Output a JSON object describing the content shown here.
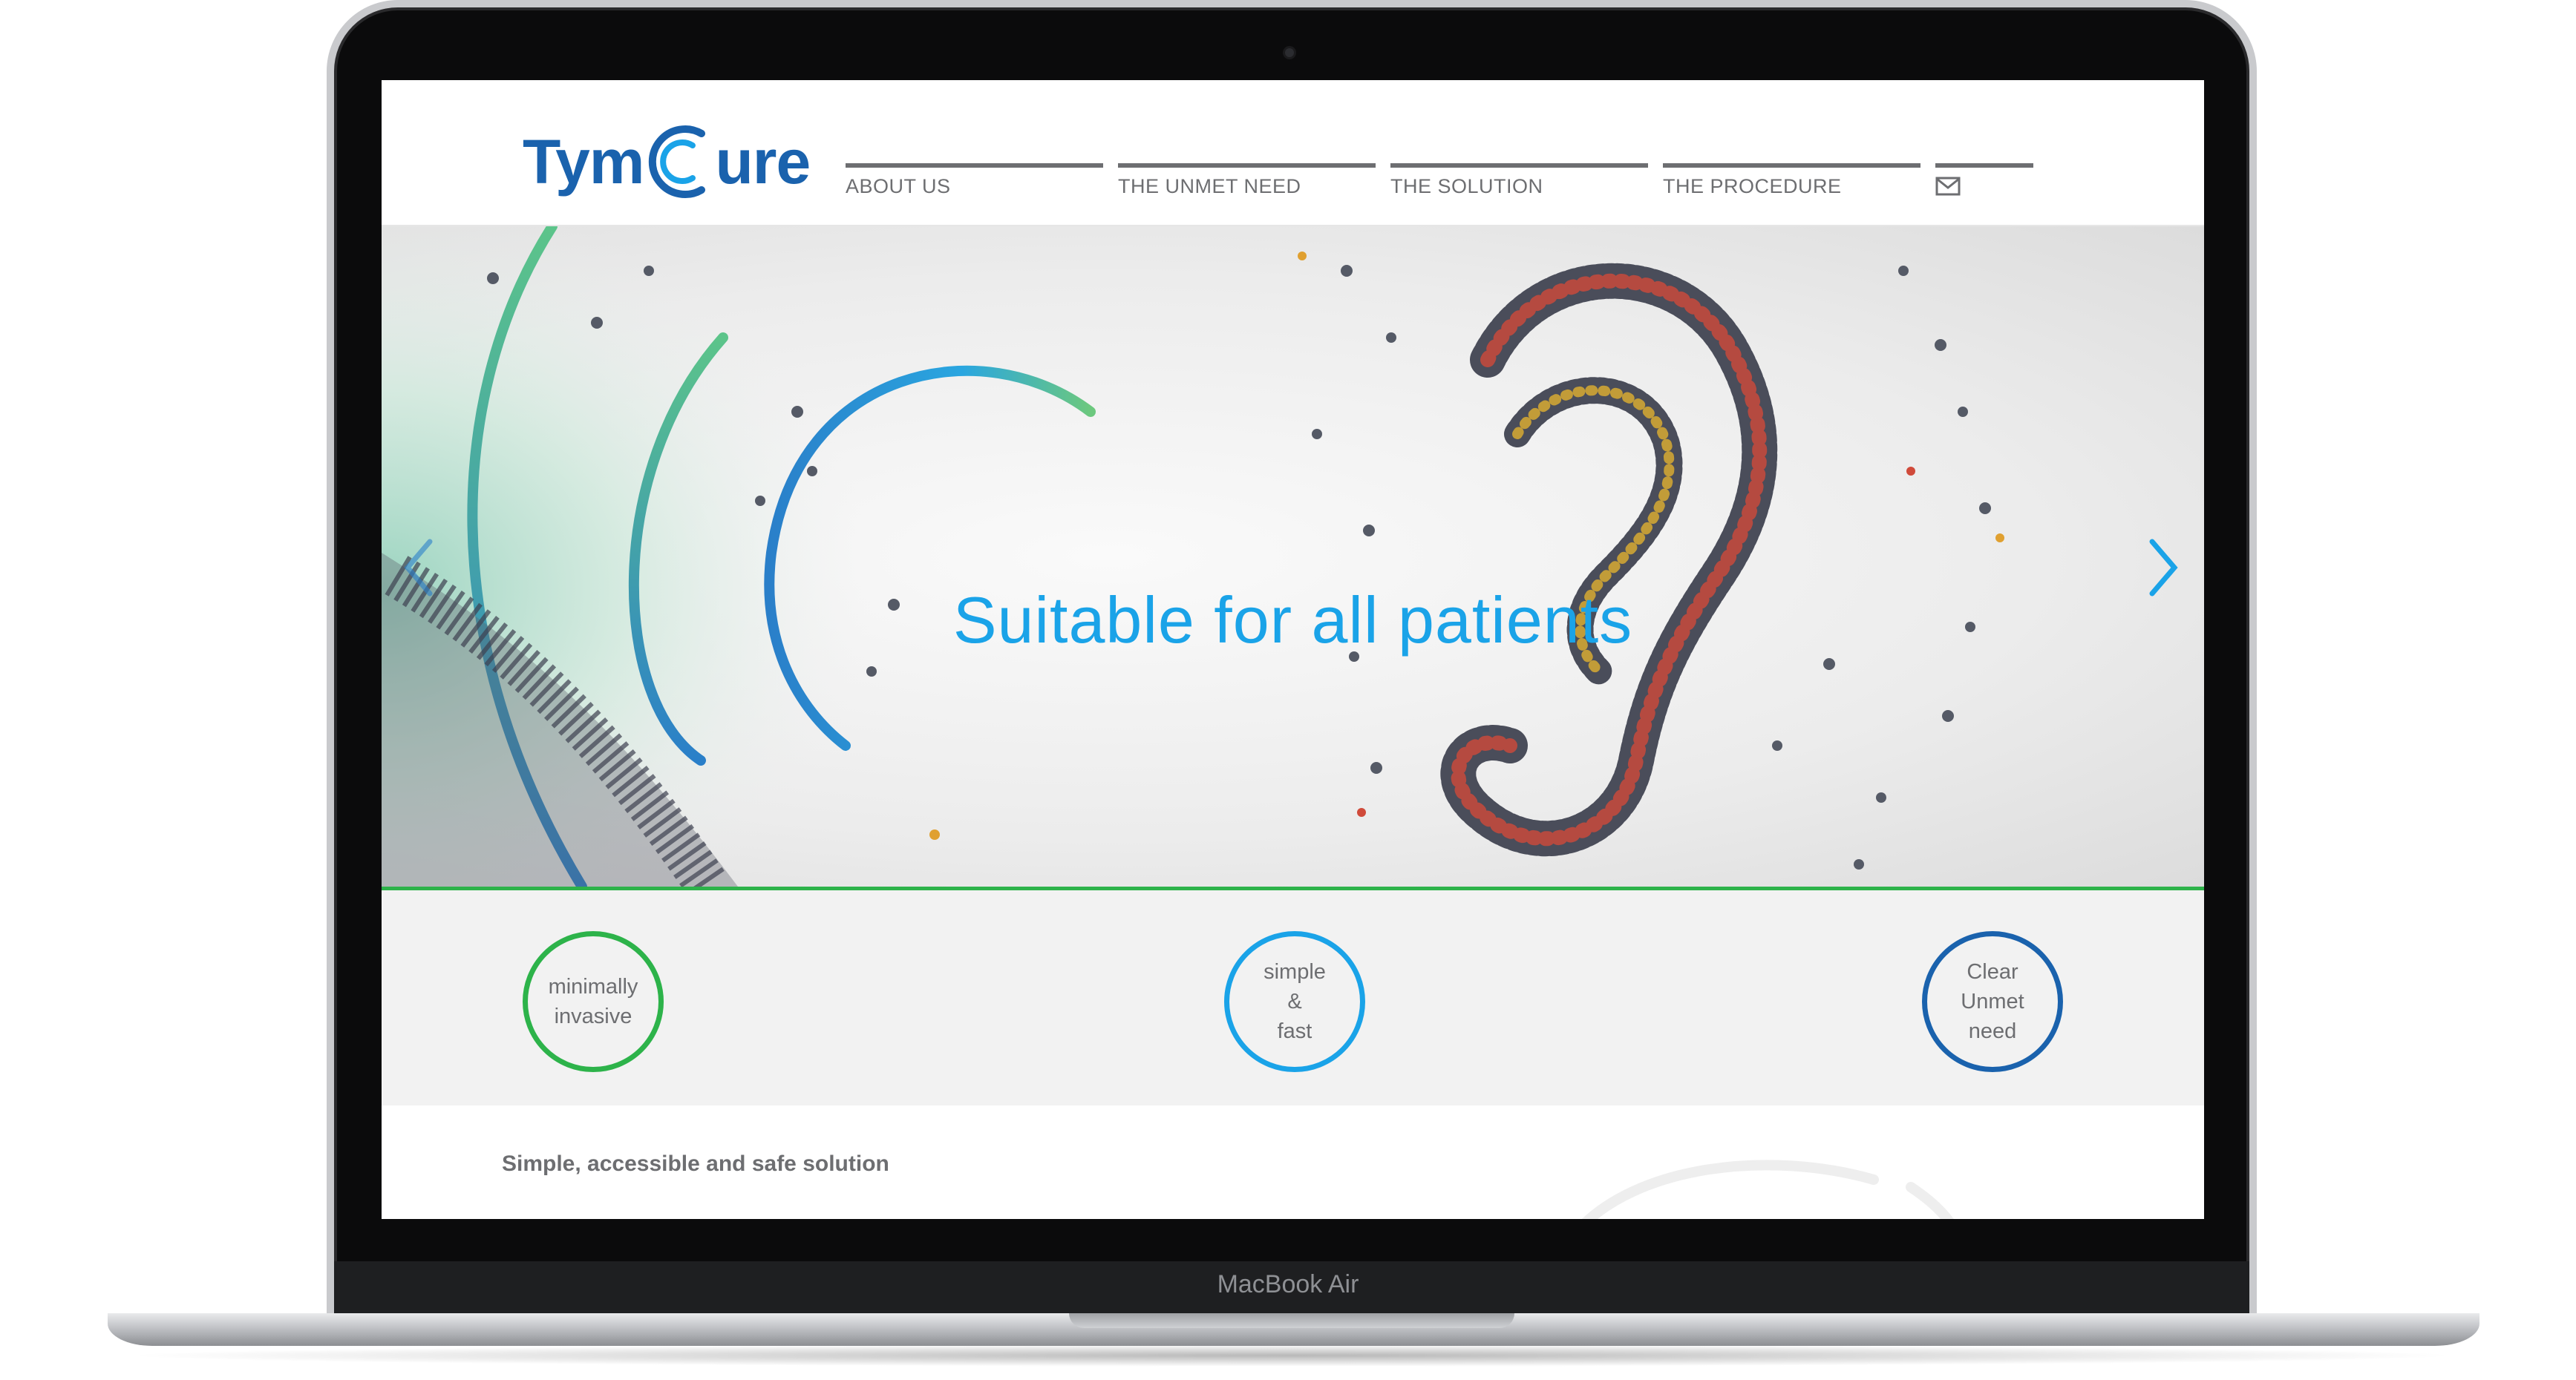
{
  "device": {
    "model_label": "MacBook Air"
  },
  "site": {
    "logo": {
      "text_left": "Tym",
      "text_right": "ure",
      "icon": "c-swirl-logo-icon"
    },
    "nav": {
      "items": [
        {
          "label": "ABOUT US"
        },
        {
          "label": "THE UNMET NEED"
        },
        {
          "label": "THE SOLUTION"
        },
        {
          "label": "THE PROCEDURE"
        }
      ],
      "mail_icon": "envelope-icon"
    },
    "hero": {
      "title": "Suitable for all patients",
      "prev_icon": "chevron-left-icon",
      "next_icon": "chevron-right-icon"
    },
    "features": [
      {
        "label": "minimally\ninvasive",
        "color": "#2db34a"
      },
      {
        "label": "simple\n&\nfast",
        "color": "#1aa3e8"
      },
      {
        "label": "Clear\nUnmet\nneed",
        "color": "#1a62ad"
      }
    ],
    "intro": {
      "heading": "Simple, accessible and safe solution"
    }
  },
  "colors": {
    "brand_blue": "#1a62ad",
    "accent_cyan": "#1aa3e8",
    "accent_green": "#2db34a",
    "nav_gray": "#6d6e71"
  }
}
